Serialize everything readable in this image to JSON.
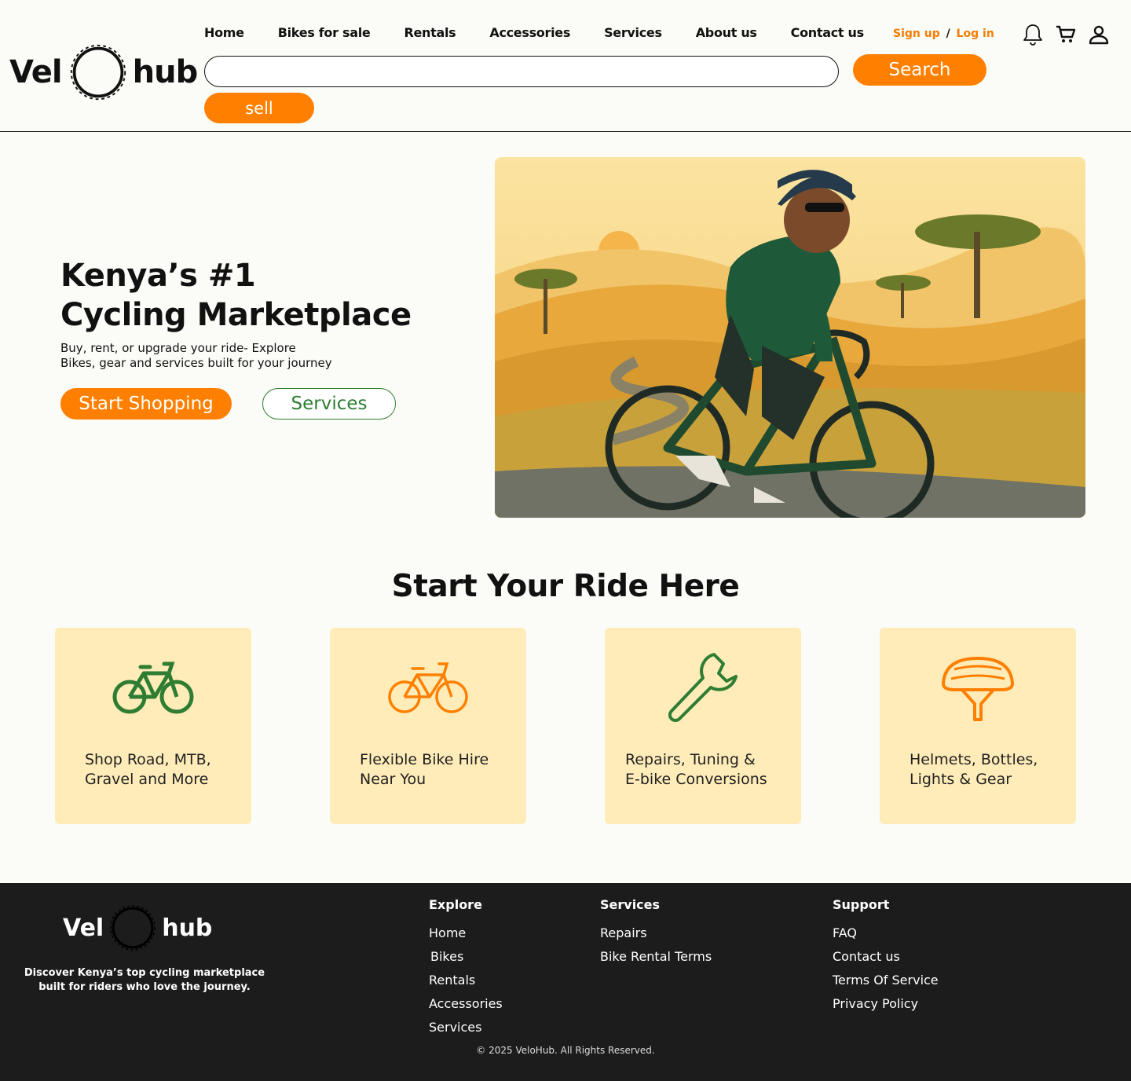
{
  "logo": {
    "left": "Vel",
    "right": "hub"
  },
  "nav": [
    "Home",
    "Bikes for sale",
    "Rentals",
    "Accessories",
    "Services",
    "About us",
    "Contact us"
  ],
  "auth": {
    "signup": "Sign up",
    "separator": "/",
    "login": "Log in"
  },
  "header_icons": [
    "bell-icon",
    "cart-icon",
    "user-icon"
  ],
  "search": {
    "value": "",
    "placeholder": "",
    "button": "Search"
  },
  "sell_button": "sell",
  "hero": {
    "title_line1": "Kenya’s #1",
    "title_line2": "Cycling Marketplace",
    "sub_line1": "Buy, rent, or upgrade your ride- Explore",
    "sub_line2": "Bikes, gear and services built for your journey",
    "primary_button": "Start Shopping",
    "secondary_button": "Services"
  },
  "section_title": "Start Your Ride Here",
  "cards": [
    {
      "icon": "bike-icon",
      "line1": "Shop Road, MTB,",
      "line2": "Gravel and More",
      "color": "#2e7d32"
    },
    {
      "icon": "bike-icon",
      "line1": "Flexible Bike Hire",
      "line2": "Near You",
      "color": "#ff8000"
    },
    {
      "icon": "wrench-icon",
      "line1": "Repairs, Tuning  &",
      "line2": "E-bike Conversions",
      "color": "#2e7d32"
    },
    {
      "icon": "helmet-icon",
      "line1": "Helmets, Bottles,",
      "line2": "Lights & Gear",
      "color": "#ff8000"
    }
  ],
  "footer": {
    "logo_left": "Vel",
    "logo_right": "hub",
    "tagline_line1": "Discover Kenya’s top cycling marketplace",
    "tagline_line2": "built for riders who love the journey.",
    "explore": {
      "title": "Explore",
      "links": [
        "Home",
        "Bikes",
        "Rentals",
        "Accessories",
        "Services"
      ]
    },
    "services": {
      "title": "Services",
      "links": [
        "Repairs",
        "Bike Rental Terms"
      ]
    },
    "support": {
      "title": "Support",
      "links": [
        "FAQ",
        "Contact us",
        "Terms Of Service",
        "Privacy Policy"
      ]
    },
    "copyright": "© 2025 VeloHub. All Rights Reserved."
  },
  "colors": {
    "accent": "#ff8000",
    "green": "#2e7d32",
    "card_bg": "#ffecb9",
    "footer_bg": "#1c1c1c"
  }
}
